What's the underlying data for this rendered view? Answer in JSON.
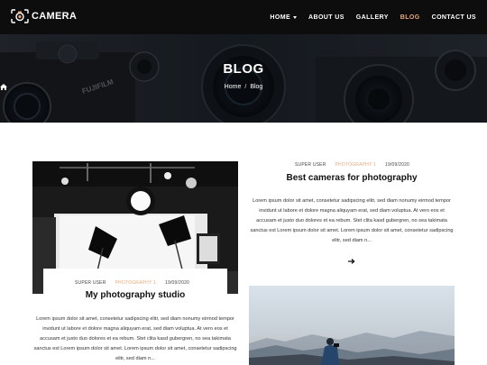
{
  "brand": {
    "name": "CAMERA"
  },
  "nav": {
    "items": [
      {
        "label": "HOME",
        "has_dropdown": true,
        "active": false
      },
      {
        "label": "ABOUT US",
        "has_dropdown": false,
        "active": false
      },
      {
        "label": "GALLERY",
        "has_dropdown": false,
        "active": false
      },
      {
        "label": "BLOG",
        "has_dropdown": false,
        "active": true
      },
      {
        "label": "CONTACT US",
        "has_dropdown": false,
        "active": false
      }
    ]
  },
  "hero": {
    "title": "BLOG",
    "breadcrumb": {
      "home": "Home",
      "separator": "/",
      "current": "Blog"
    }
  },
  "posts": [
    {
      "author": "SUPER USER",
      "category": "PHOTOGRAPHY 1",
      "date": "19/09/2020",
      "title": "My photography studio",
      "excerpt": "Lorem ipsum dolor sit amet, consetetur sadipscing elitr, sed diam nonumy eirmod tempor invidunt ut labore et dolore magna aliquyam erat, sed diam voluptua. At vero eos et accusam et justo duo dolores et ea rebum. Stet clita kasd gubergren, no sea takimata sanctus est Lorem ipsum dolor sit amet. Lorem ipsum dolor sit amet, consetetur sadipscing elitr, sed diam n..."
    },
    {
      "author": "SUPER USER",
      "category": "PHOTOGRAPHY 1",
      "date": "19/09/2020",
      "title": "Best cameras for photography",
      "excerpt": "Lorem ipsum dolor sit amet, consetetur sadipscing elitr, sed diam nonumy eirmod tempor invidunt ut labore et dolore magna aliquyam erat, sed diam voluptua. At vero eos et accusam et justo duo dolores et ea rebum. Stet clita kasd gubergren, no sea takimata sanctus est Lorem ipsum dolor sit amet. Lorem ipsum dolor sit amet, consetetur sadipscing elitr, sed diam n..."
    }
  ],
  "colors": {
    "accent": "#e8a87c",
    "nav_bg": "#0d0d0d",
    "text": "#111111"
  },
  "icons": {
    "logo": "camera-icon",
    "home": "home-icon",
    "read_more": "arrow-right-icon",
    "dropdown": "chevron-down-icon"
  }
}
